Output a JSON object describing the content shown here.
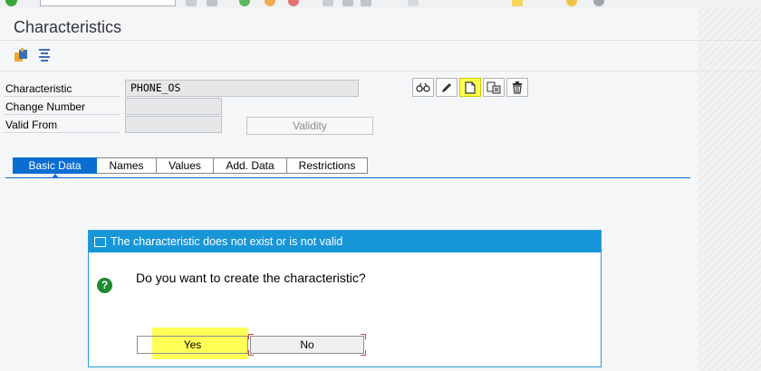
{
  "toolbar": {
    "icons": [
      "enter-icon",
      "command-field",
      "back-icon",
      "save-icon",
      "green-arrow-icon",
      "exit-icon",
      "cancel-icon",
      "print-icon",
      "find-icon",
      "first-page-icon",
      "new-session-icon",
      "shortcut-icon",
      "help-icon",
      "settings-icon"
    ]
  },
  "page": {
    "title": "Characteristics"
  },
  "app_toolbar": {
    "icons": [
      "other-object-icon",
      "classes-icon"
    ]
  },
  "form": {
    "characteristic_label": "Characteristic",
    "characteristic_value": "PHONE_OS",
    "change_number_label": "Change Number",
    "change_number_value": "",
    "valid_from_label": "Valid From",
    "valid_from_value": "",
    "validity_button": "Validity"
  },
  "actions": [
    "display-icon",
    "change-icon",
    "create-icon",
    "create-with-ref-icon",
    "delete-icon"
  ],
  "tabs": [
    {
      "label": "Basic Data",
      "active": true
    },
    {
      "label": "Names",
      "active": false
    },
    {
      "label": "Values",
      "active": false
    },
    {
      "label": "Add. Data",
      "active": false
    },
    {
      "label": "Restrictions",
      "active": false
    }
  ],
  "dialog": {
    "title": "The characteristic does not exist or is not valid",
    "question": "Do you want to create the characteristic?",
    "yes_label": "Yes",
    "no_label": "No"
  },
  "colors": {
    "accent": "#0a6ed1",
    "dialog_header": "#1796d7",
    "highlight": "#ffff57",
    "question_icon": "#1e8a2f"
  }
}
